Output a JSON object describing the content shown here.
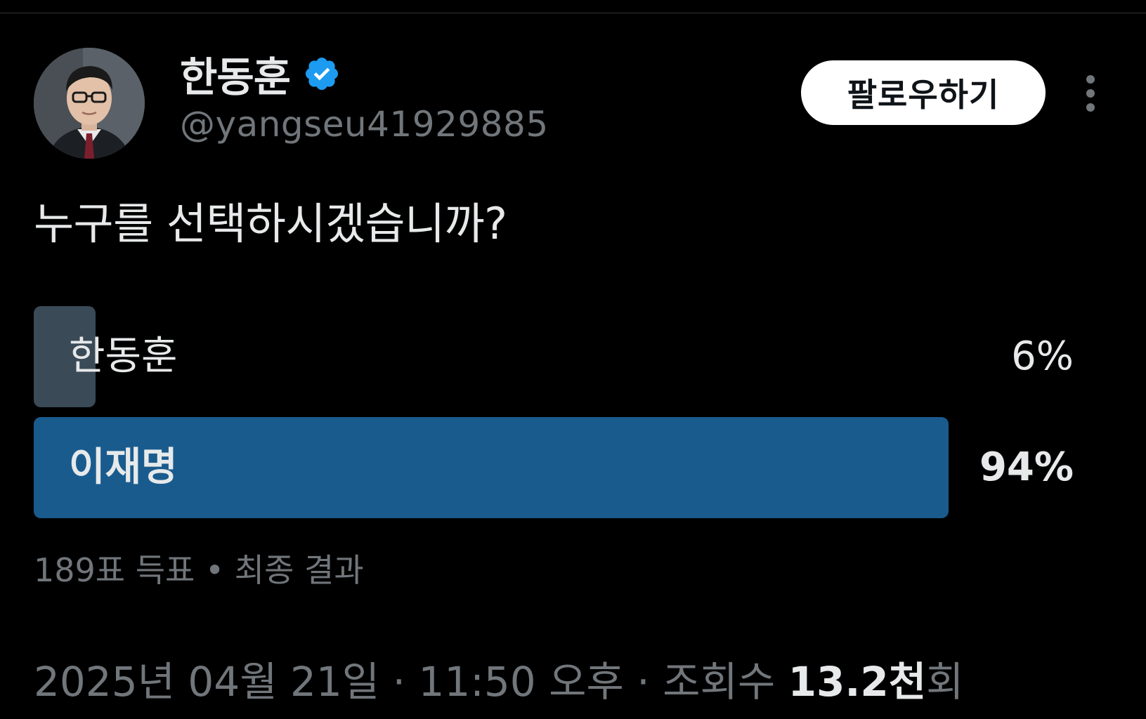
{
  "author": {
    "display_name": "한동훈",
    "handle": "@yangseu41929885",
    "verified_color": "#1d9bf0"
  },
  "follow_button": {
    "label": "팔로우하기"
  },
  "tweet": {
    "text": "누구를 선택하시겠습니까?"
  },
  "poll": {
    "options": [
      {
        "label": "한동훈",
        "percent_text": "6%",
        "percent": 6,
        "winner": false,
        "bar_color": "#3a4a57"
      },
      {
        "label": "이재명",
        "percent_text": "94%",
        "percent": 94,
        "winner": true,
        "bar_color": "#1a5b8e"
      }
    ],
    "meta": "189표 득표 • 최종 결과"
  },
  "footer": {
    "date": "2025년 04월 21일",
    "sep1": " · ",
    "time": "11:50 오후",
    "sep2": " · ",
    "views_label": "조회수 ",
    "views_count": "13.2천",
    "views_suffix": "회"
  },
  "icons": {
    "verified": "verified-badge-icon",
    "more": "more-vertical-icon"
  }
}
